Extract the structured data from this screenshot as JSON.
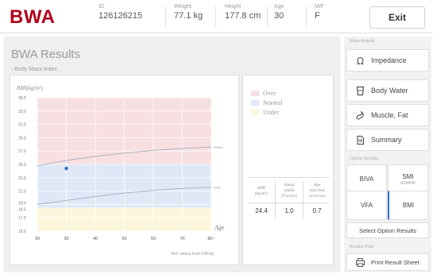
{
  "header": {
    "logo": "BWA",
    "fields": [
      {
        "label": "ID",
        "value": "126126215"
      },
      {
        "label": "Weight",
        "value": "77.1 kg"
      },
      {
        "label": "Height",
        "value": "177.8 cm"
      },
      {
        "label": "Age",
        "value": "30"
      },
      {
        "label": "M/F",
        "value": "F"
      }
    ],
    "exit_label": "Exit"
  },
  "main": {
    "title": "BWA Results",
    "subtitle": "› Body Mass Index"
  },
  "chart_data": {
    "type": "line",
    "ylabel": "BMI(kg/m²)",
    "xlabel": "Age",
    "x_ticks": [
      "20",
      "30",
      "40",
      "50",
      "60",
      "70",
      "80~"
    ],
    "y_ticks": [
      "35.0",
      "33.0",
      "31.0",
      "29.0",
      "27.0",
      "25.0",
      "23.0",
      "21.0",
      "19.0",
      "18.5",
      "17.0",
      "15.0"
    ],
    "ylim": [
      15,
      35
    ],
    "xlim": [
      20,
      80
    ],
    "bands": [
      {
        "name": "Over",
        "from": 25,
        "to": 35,
        "color": "#f8dfe1"
      },
      {
        "name": "Normal",
        "from": 18.5,
        "to": 25,
        "color": "#dfe8f6"
      },
      {
        "name": "Under",
        "from": 15,
        "to": 18.5,
        "color": "#fcf6dc"
      }
    ],
    "series": [
      {
        "name": "upper",
        "label": "50%ile",
        "x": [
          20,
          30,
          40,
          50,
          60,
          70,
          80
        ],
        "y": [
          24.8,
          25.6,
          26.2,
          26.7,
          27.1,
          27.4,
          27.6
        ]
      },
      {
        "name": "lower",
        "label": "5%ile",
        "x": [
          20,
          30,
          40,
          50,
          60,
          70,
          80
        ],
        "y": [
          19.0,
          19.6,
          20.2,
          20.7,
          21.1,
          21.4,
          21.6
        ]
      }
    ],
    "point": {
      "x": 30,
      "y": 24.4
    },
    "note": "Ref. values from InBody"
  },
  "legend": {
    "items": [
      {
        "label": "Over",
        "color": "#f8dfe1"
      },
      {
        "label": "Normal",
        "color": "#dfe8f6"
      },
      {
        "label": "Under",
        "color": "#fcf6dc"
      }
    ]
  },
  "table": {
    "headers": [
      {
        "l1": "BMI",
        "l2": "(kg/m²)"
      },
      {
        "l1": "Young",
        "l2": "adults",
        "l3": "(T-score)"
      },
      {
        "l1": "Age",
        "l2": "matched",
        "l3": "(Z-score)"
      }
    ],
    "values": [
      "24.4",
      "1.0",
      "0.7"
    ]
  },
  "sidebar": {
    "main_label": "Main Results",
    "items": [
      {
        "label": "Impedance",
        "icon": "ohm-icon"
      },
      {
        "label": "Body Water",
        "icon": "water-glass-icon"
      },
      {
        "label": "Muscle, Fat",
        "icon": "arm-muscle-icon"
      },
      {
        "label": "Summary",
        "icon": "document-icon"
      }
    ],
    "option_label": "Option Results",
    "options": [
      {
        "label": "BIVA"
      },
      {
        "label": "SMI",
        "sub": "ASM/Ht²"
      },
      {
        "label": "VFA"
      },
      {
        "label": "BMI"
      }
    ],
    "select_label": "Select Option Results",
    "print_section": "Results Print",
    "print_label": "Print Result Sheet",
    "accent": "#2f6fd0"
  }
}
